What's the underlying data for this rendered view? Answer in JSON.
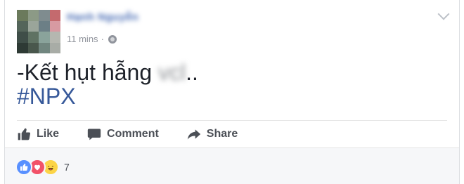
{
  "post": {
    "author_name": "Hạnh Nguyễn",
    "timestamp": "11 mins",
    "separator": "·",
    "audience_icon": "globe-icon",
    "menu_icon": "chevron-down-icon",
    "text_main": "-Kết hụt hẫng ",
    "text_blurred": "vcl",
    "text_end": "..",
    "hashtag": "#NPX"
  },
  "actions": {
    "like_label": "Like",
    "comment_label": "Comment",
    "share_label": "Share"
  },
  "reactions": {
    "icons": [
      "like-reaction-icon",
      "love-reaction-icon",
      "haha-reaction-icon"
    ],
    "count": "7"
  },
  "colors": {
    "link_blue": "#365899",
    "name_blue": "#4267b2",
    "text": "#1d2129",
    "muted": "#90949c",
    "like": "#5890ff",
    "love": "#f25268",
    "haha": "#fcd447"
  }
}
